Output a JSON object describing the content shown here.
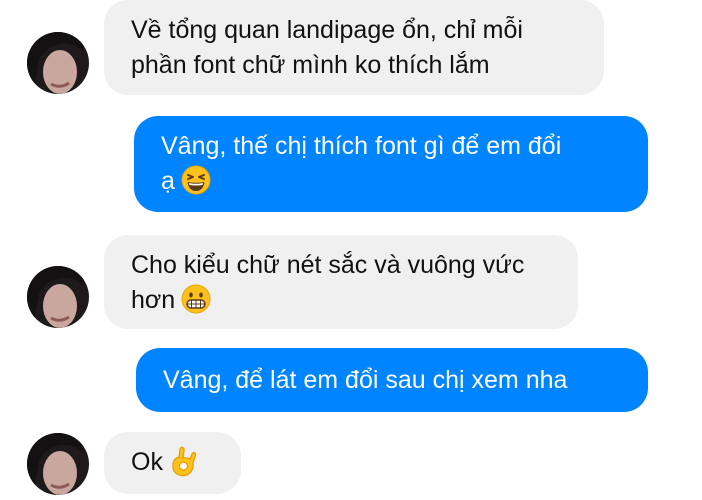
{
  "messages": [
    {
      "sender": "them",
      "lines": [
        "Về tổng quan landipage ổn, chỉ mỗi",
        "phần font chữ mình ko thích lắm"
      ],
      "emoji": ""
    },
    {
      "sender": "me",
      "lines": [
        "Vâng, thế chị thích font gì để em đổi",
        "ạ"
      ],
      "emoji": "grinning-squinting-face-icon"
    },
    {
      "sender": "them",
      "lines": [
        "Cho kiểu chữ nét sắc và vuông vức",
        "hơn"
      ],
      "emoji": "grimacing-face-icon"
    },
    {
      "sender": "me",
      "lines": [
        "Vâng, để lát em đổi sau chị xem nha"
      ],
      "emoji": ""
    },
    {
      "sender": "them",
      "lines": [
        "Ok"
      ],
      "emoji": "ok-hand-icon"
    }
  ],
  "colors": {
    "outgoing_bubble": "#0084ff",
    "incoming_bubble": "#f1f0f0",
    "incoming_text": "#111111",
    "outgoing_text": "#ffffff"
  }
}
